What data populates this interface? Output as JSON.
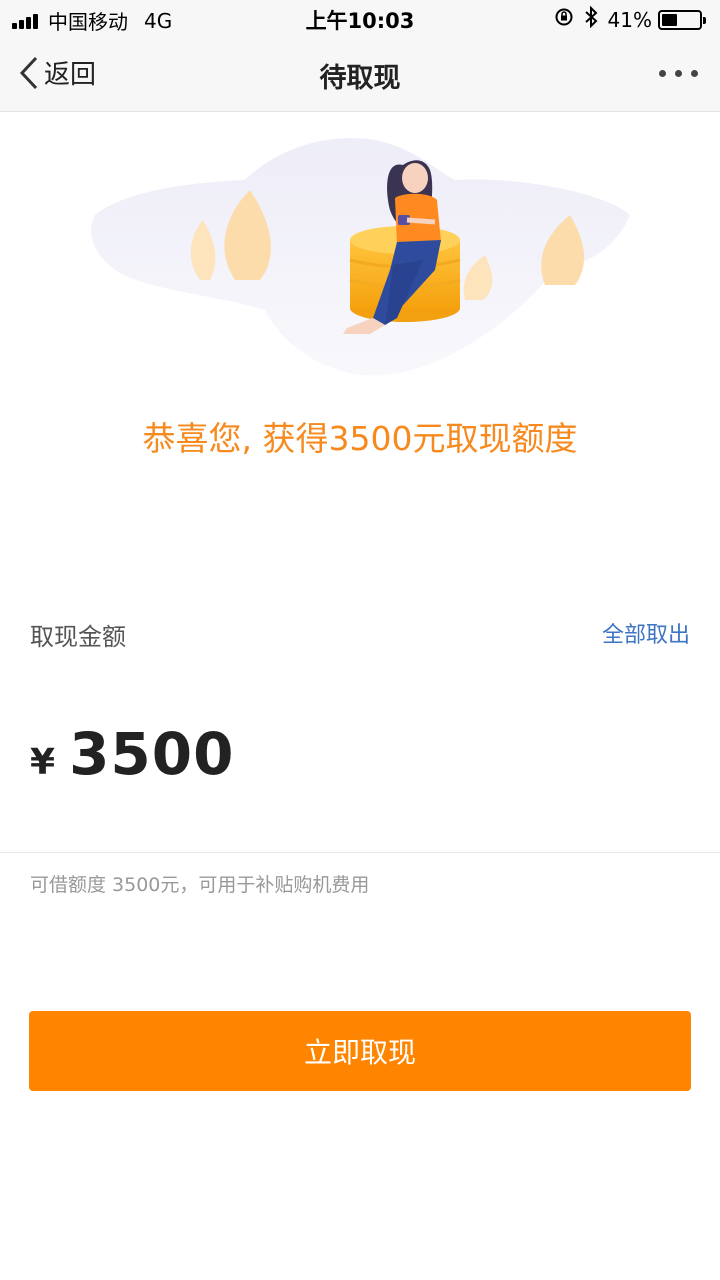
{
  "status_bar": {
    "carrier": "中国移动",
    "network": "4G",
    "time": "上午10:03",
    "battery": "41%",
    "battery_level": 0.41
  },
  "nav": {
    "back_label": "返回",
    "title": "待取现"
  },
  "hero": {
    "message": "恭喜您, 获得3500元取现额度"
  },
  "withdraw": {
    "label": "取现金额",
    "withdraw_all": "全部取出",
    "currency": "¥",
    "amount": "3500",
    "note": "可借额度 3500元，可用于补贴购机费用"
  },
  "button": {
    "label": "立即取现"
  },
  "colors": {
    "accent": "#ff8500",
    "message": "#f68a1e",
    "link": "#3d75c4"
  }
}
